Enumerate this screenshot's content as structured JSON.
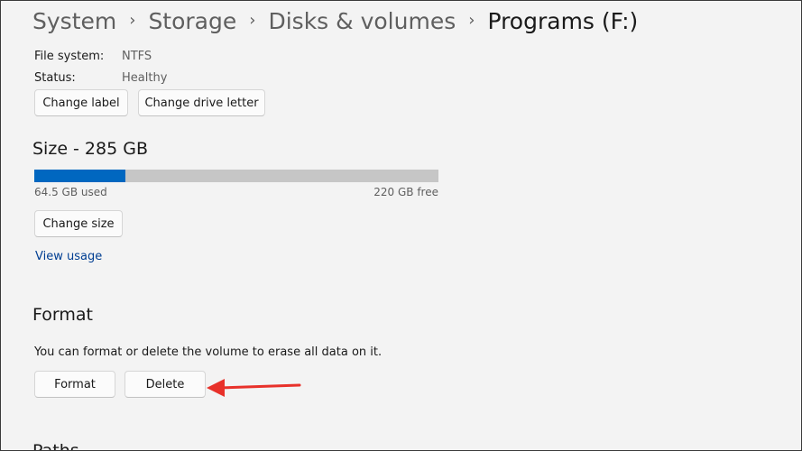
{
  "breadcrumb": {
    "items": [
      "System",
      "Storage",
      "Disks & volumes",
      "Programs (F:)"
    ],
    "separator": "›"
  },
  "properties": {
    "file_system_label": "File system:",
    "file_system_value": "NTFS",
    "status_label": "Status:",
    "status_value": "Healthy"
  },
  "label_buttons": {
    "change_label": "Change label",
    "change_drive_letter": "Change drive letter"
  },
  "size": {
    "title": "Size - 285 GB",
    "used_label": "64.5 GB used",
    "free_label": "220 GB free",
    "used_fraction": 0.226,
    "change_size_button": "Change size",
    "view_usage_link": "View usage",
    "bar_used_color": "#0067c0",
    "bar_free_color": "#c6c6c6"
  },
  "format": {
    "title": "Format",
    "description": "You can format or delete the volume to erase all data on it.",
    "format_button": "Format",
    "delete_button": "Delete"
  },
  "next_section": {
    "title_partial": "Paths"
  },
  "annotation": {
    "arrow_color": "#e8312a",
    "icon": "arrow-left-icon"
  }
}
